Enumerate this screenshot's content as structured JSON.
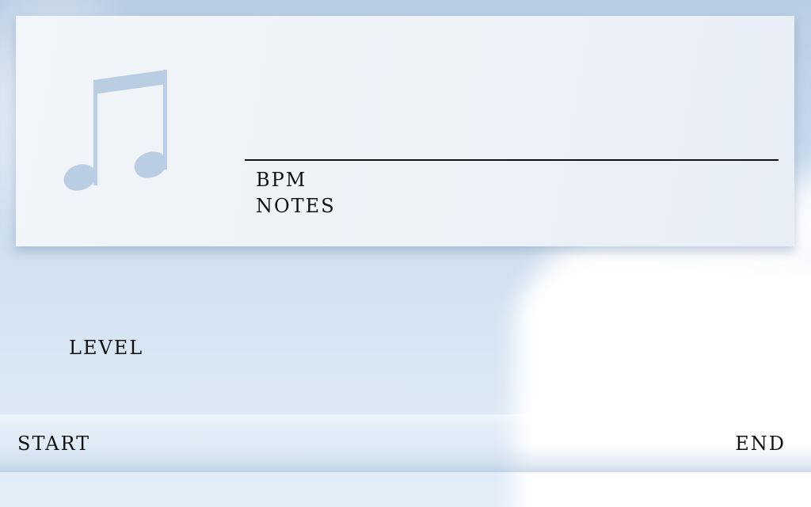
{
  "song_card": {
    "icon": "music-note-icon",
    "bpm_label": "BPM",
    "notes_label": "NOTES"
  },
  "level_label": "LEVEL",
  "footer": {
    "start_label": "START",
    "end_label": "END"
  },
  "colors": {
    "background": "#c7d9ec",
    "card": "#edf2f7",
    "icon": "#b7cbe2",
    "text": "#111111"
  }
}
